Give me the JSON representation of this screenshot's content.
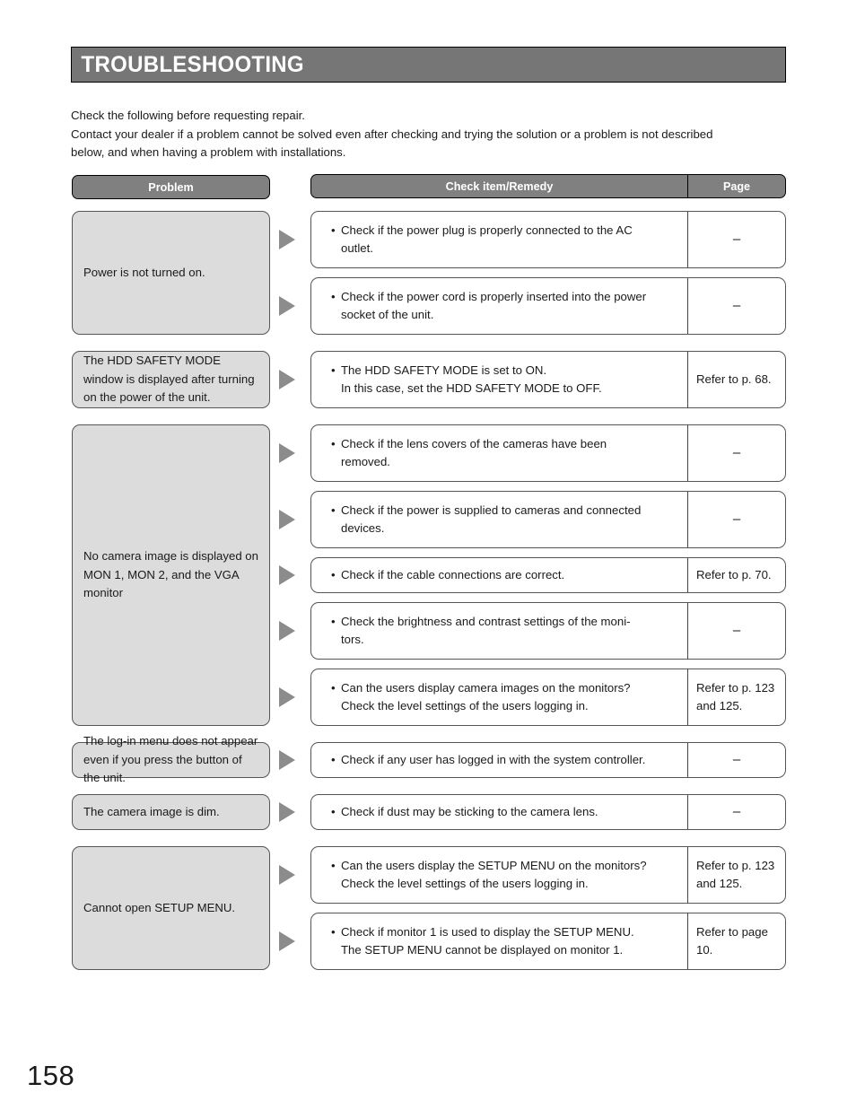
{
  "header": {
    "title": "TROUBLESHOOTING"
  },
  "intro": {
    "line1": "Check the following before requesting repair.",
    "line2": "Contact your dealer if a problem cannot be solved even after checking and trying the solution or a problem is not described",
    "line3": "below, and when having a problem with installations."
  },
  "table": {
    "headers": {
      "problem": "Problem",
      "remedy": "Check item/Remedy",
      "page": "Page"
    },
    "groups": [
      {
        "problem": "Power is not turned on.",
        "rows": [
          {
            "line1": "Check if the power plug is properly connected to the AC",
            "line2": "outlet.",
            "page": "–",
            "page_align": "center"
          },
          {
            "line1": "Check if the power cord is properly inserted into the power",
            "line2": "socket of the unit.",
            "page": "–",
            "page_align": "center"
          }
        ]
      },
      {
        "problem": "The HDD SAFETY MODE window is displayed after turning on the power of the unit.",
        "rows": [
          {
            "line1": "The HDD SAFETY MODE is set to ON.",
            "line2": "In this case, set the HDD SAFETY MODE to OFF.",
            "page": "Refer to p. 68.",
            "page_align": "left"
          }
        ]
      },
      {
        "problem": "No camera image is displayed on MON 1, MON 2, and the VGA monitor",
        "rows": [
          {
            "line1": "Check if the lens covers of the cameras have been",
            "line2": "removed.",
            "page": "–",
            "page_align": "center"
          },
          {
            "line1": "Check if the power is supplied to cameras and connected",
            "line2": "devices.",
            "page": "–",
            "page_align": "center"
          },
          {
            "line1": "Check if the cable connections are correct.",
            "line2": "",
            "page": "Refer to p. 70.",
            "page_align": "left"
          },
          {
            "line1": "Check the brightness and contrast settings of the moni-",
            "line2": "tors.",
            "page": "–",
            "page_align": "center"
          },
          {
            "line1": "Can the users display camera images on the monitors?",
            "line2": "Check the level settings of the users logging in.",
            "page": "Refer to p. 123 and 125.",
            "page_align": "left"
          }
        ]
      },
      {
        "problem": "The log-in menu does not appear even if you press the button of the unit.",
        "rows": [
          {
            "line1": "Check if any user has logged in with the system controller.",
            "line2": "",
            "page": "–",
            "page_align": "center"
          }
        ]
      },
      {
        "problem": "The camera image is dim.",
        "rows": [
          {
            "line1": "Check if dust may be sticking to the camera lens.",
            "line2": "",
            "page": "–",
            "page_align": "center"
          }
        ]
      },
      {
        "problem": "Cannot open SETUP MENU.",
        "rows": [
          {
            "line1": "Can the users display the SETUP MENU on the monitors?",
            "line2": "Check the level settings of the users logging in.",
            "page": "Refer to p. 123 and 125.",
            "page_align": "left"
          },
          {
            "line1": "Check if monitor 1 is used to display the SETUP MENU.",
            "line2": "The SETUP MENU cannot be displayed on monitor 1.",
            "page": "Refer to page 10.",
            "page_align": "left"
          }
        ]
      }
    ]
  },
  "folio": "158",
  "bullet": "•"
}
